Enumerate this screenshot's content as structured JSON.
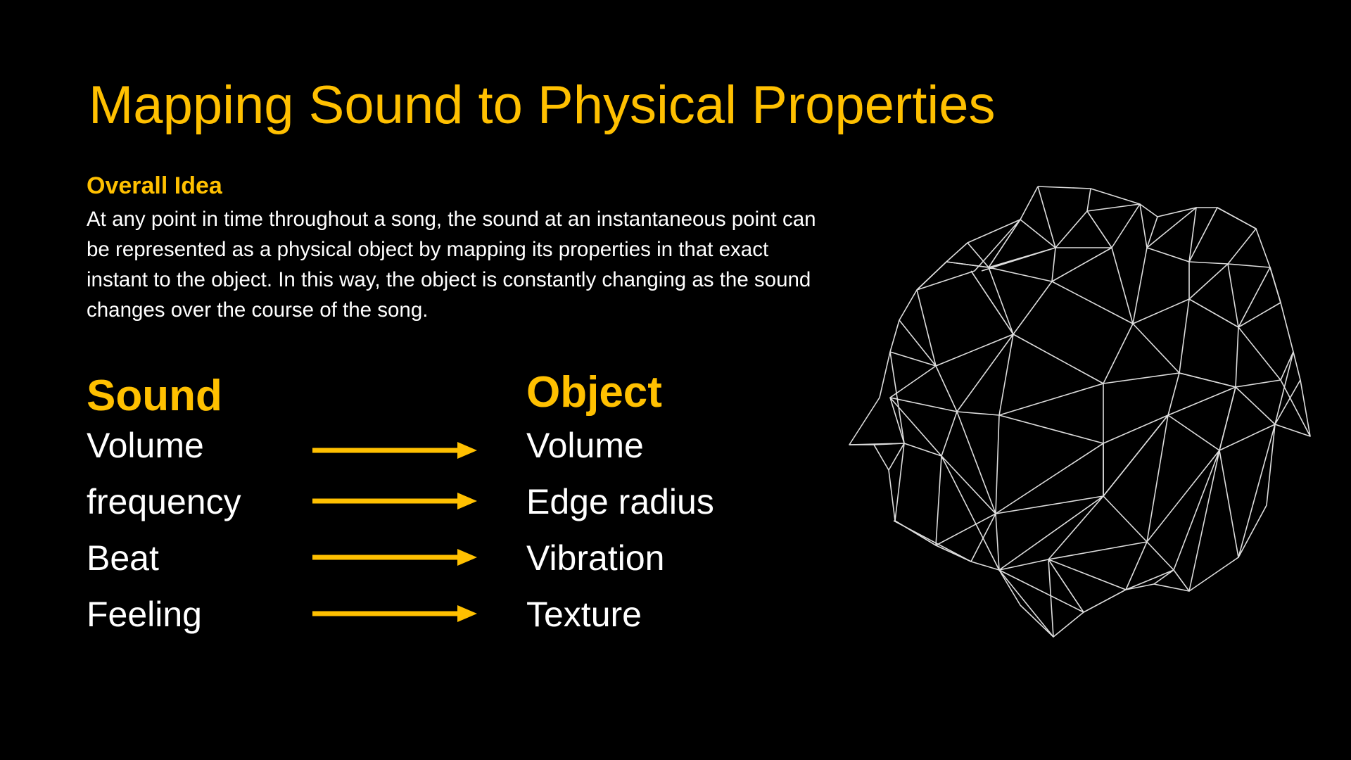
{
  "slide": {
    "title": "Mapping Sound to Physical Properties",
    "overall_idea": {
      "heading": "Overall Idea",
      "text": "At any point in time throughout a song, the sound at an instantaneous point can be represented as a physical object by mapping its properties in that exact instant to the object. In this way, the object is constantly changing as the sound changes over the course of the song."
    },
    "mapping": {
      "left_heading": "Sound",
      "right_heading": "Object",
      "rows": [
        {
          "sound": "Volume",
          "object": "Volume"
        },
        {
          "sound": "frequency",
          "object": "Edge radius"
        },
        {
          "sound": "Beat",
          "object": "Vibration"
        },
        {
          "sound": "Feeling",
          "object": "Texture"
        }
      ]
    }
  },
  "colors": {
    "background": "#000000",
    "accent": "#FFC000",
    "text": "#FFFFFF",
    "mesh": "#DDDDDD"
  },
  "icons": {
    "arrow": "right-arrow-icon",
    "mesh": "wireframe-polyhedron-illustration"
  }
}
